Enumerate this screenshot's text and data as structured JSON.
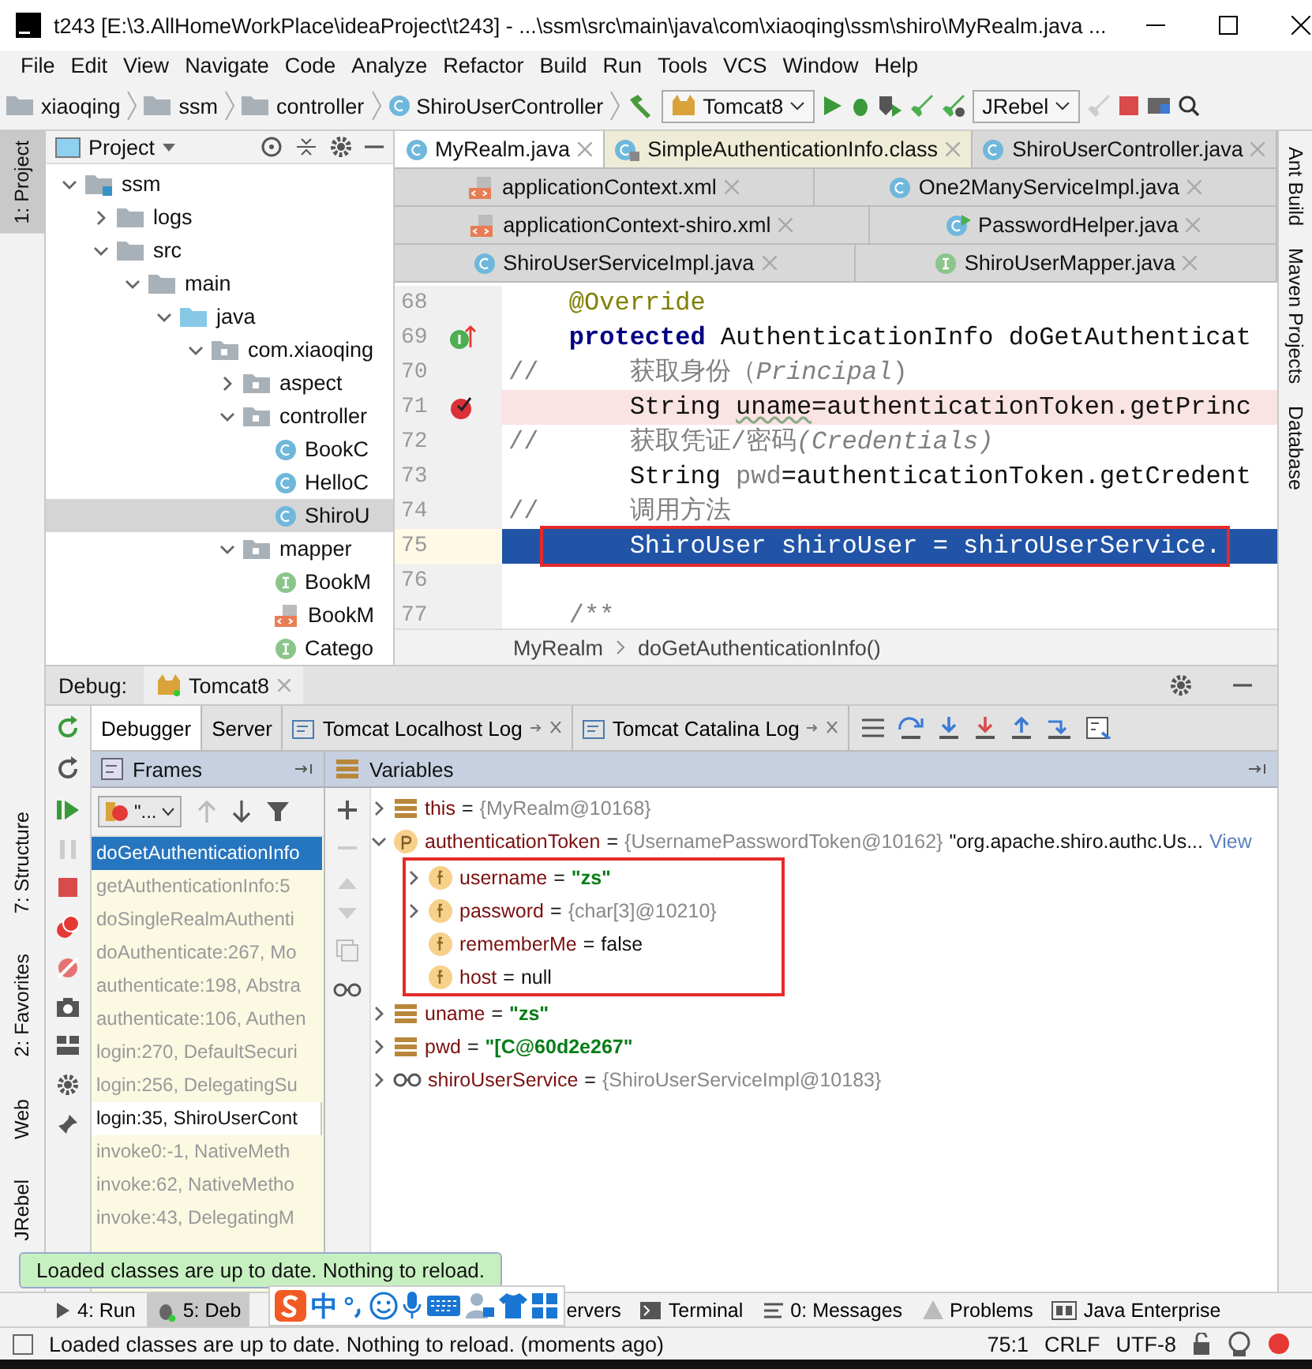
{
  "window": {
    "title": "t243 [E:\\3.AllHomeWorkPlace\\ideaProject\\t243] - ...\\ssm\\src\\main\\java\\com\\xiaoqing\\ssm\\shiro\\MyRealm.java ..."
  },
  "menu": [
    "File",
    "Edit",
    "View",
    "Navigate",
    "Code",
    "Analyze",
    "Refactor",
    "Build",
    "Run",
    "Tools",
    "VCS",
    "Window",
    "Help"
  ],
  "nav_path": [
    {
      "label": "xiaoqing",
      "kind": "folder"
    },
    {
      "label": "ssm",
      "kind": "folder"
    },
    {
      "label": "controller",
      "kind": "folder"
    },
    {
      "label": "ShiroUserController",
      "kind": "class"
    }
  ],
  "run_config": "Tomcat8",
  "jrebel_mode": "JRebel",
  "left_tool_tabs": {
    "top": [
      {
        "label": "1: Project",
        "selected": true
      }
    ],
    "bottom": [
      {
        "label": "7: Structure",
        "selected": false
      },
      {
        "label": "2: Favorites",
        "selected": false
      },
      {
        "label": "Web",
        "selected": false
      },
      {
        "label": "JRebel",
        "selected": false
      }
    ]
  },
  "right_tool_tabs": [
    "Ant Build",
    "Maven Projects",
    "Database"
  ],
  "project": {
    "title": "Project",
    "tree": [
      {
        "label": "ssm",
        "kind": "module",
        "expanded": true,
        "selected": false,
        "children": [
          {
            "label": "logs",
            "kind": "folder",
            "expanded": false,
            "selected": false
          },
          {
            "label": "src",
            "kind": "folder",
            "expanded": true,
            "selected": false,
            "children": [
              {
                "label": "main",
                "kind": "folder",
                "expanded": true,
                "selected": false,
                "children": [
                  {
                    "label": "java",
                    "kind": "source",
                    "expanded": true,
                    "selected": false,
                    "children": [
                      {
                        "label": "com.xiaoqing",
                        "kind": "package",
                        "expanded": true,
                        "selected": false,
                        "children": [
                          {
                            "label": "aspect",
                            "kind": "package",
                            "expanded": false,
                            "selected": false
                          },
                          {
                            "label": "controller",
                            "kind": "package",
                            "expanded": true,
                            "selected": false,
                            "children": [
                              {
                                "label": "BookC",
                                "kind": "class",
                                "selected": false
                              },
                              {
                                "label": "HelloC",
                                "kind": "class",
                                "selected": false
                              },
                              {
                                "label": "ShiroU",
                                "kind": "class",
                                "selected": true
                              }
                            ]
                          },
                          {
                            "label": "mapper",
                            "kind": "package",
                            "expanded": true,
                            "selected": false,
                            "children": [
                              {
                                "label": "BookM",
                                "kind": "interface",
                                "selected": false
                              },
                              {
                                "label": "BookM",
                                "kind": "xml",
                                "selected": false
                              },
                              {
                                "label": "Catego",
                                "kind": "interface",
                                "selected": false
                              }
                            ]
                          }
                        ]
                      }
                    ]
                  }
                ]
              }
            ]
          }
        ]
      }
    ]
  },
  "editor": {
    "tab_rows": [
      [
        {
          "label": "MyRealm.java",
          "kind": "class",
          "selected": true
        },
        {
          "label": "SimpleAuthenticationInfo.class",
          "kind": "library",
          "selected": false
        },
        {
          "label": "ShiroUserController.java",
          "kind": "class",
          "selected": false
        }
      ],
      [
        {
          "label": "applicationContext.xml",
          "kind": "xml",
          "selected": false
        },
        {
          "label": "One2ManyServiceImpl.java",
          "kind": "class",
          "selected": false
        }
      ],
      [
        {
          "label": "applicationContext-shiro.xml",
          "kind": "xml",
          "selected": false
        },
        {
          "label": "PasswordHelper.java",
          "kind": "runnable",
          "selected": false
        }
      ],
      [
        {
          "label": "ShiroUserServiceImpl.java",
          "kind": "class",
          "selected": false
        },
        {
          "label": "ShiroUserMapper.java",
          "kind": "interface",
          "selected": false
        }
      ]
    ],
    "lines": [
      {
        "number": "68",
        "kind": "normal",
        "tokens": [
          {
            "text": "    @Override",
            "kind": "annotation"
          }
        ]
      },
      {
        "number": "69",
        "kind": "override",
        "tokens": [
          {
            "text": "    protected",
            "kind": "keyword"
          },
          {
            "text": " AuthenticationInfo doGetAuthenticat",
            "kind": "plain"
          }
        ]
      },
      {
        "number": "70",
        "kind": "normal",
        "tokens": [
          {
            "text": "//      获取身份（",
            "kind": "comment"
          },
          {
            "text": "Principal",
            "kind": "italic"
          },
          {
            "text": ")",
            "kind": "comment"
          }
        ]
      },
      {
        "number": "71",
        "kind": "breakpoint",
        "tokens": [
          {
            "text": "        String ",
            "kind": "plain"
          },
          {
            "text": "uname",
            "kind": "warning"
          },
          {
            "text": "=authenticationToken.getPrinc",
            "kind": "plain"
          }
        ]
      },
      {
        "number": "72",
        "kind": "normal",
        "tokens": [
          {
            "text": "//      获取凭证/密码",
            "kind": "comment"
          },
          {
            "text": "(Credentials)",
            "kind": "italic"
          }
        ]
      },
      {
        "number": "73",
        "kind": "normal",
        "tokens": [
          {
            "text": "        String ",
            "kind": "plain"
          },
          {
            "text": "pwd",
            "kind": "unused"
          },
          {
            "text": "=authenticationToken.getCredent",
            "kind": "plain"
          }
        ]
      },
      {
        "number": "74",
        "kind": "normal",
        "tokens": [
          {
            "text": "//      调用方法",
            "kind": "comment"
          }
        ]
      },
      {
        "number": "75",
        "kind": "current",
        "annotated": true,
        "tokens": [
          {
            "text": "        ShiroUser shiroUser = shiroUserService.",
            "kind": "plain"
          }
        ]
      },
      {
        "number": "76",
        "kind": "normal"
      },
      {
        "number": "77",
        "kind": "normal",
        "tokens": [
          {
            "text": "    /**",
            "kind": "comment"
          }
        ]
      }
    ],
    "breadcrumbs": [
      "MyRealm",
      "doGetAuthenticationInfo()"
    ]
  },
  "debug": {
    "label": "Debug:",
    "session": "Tomcat8",
    "tabs": [
      {
        "label": "Debugger",
        "selected": true,
        "kind": "plain"
      },
      {
        "label": "Server",
        "selected": false,
        "kind": "plain"
      },
      {
        "label": "Tomcat Localhost Log",
        "selected": false,
        "kind": "log"
      },
      {
        "label": "Tomcat Catalina Log",
        "selected": false,
        "kind": "log"
      }
    ],
    "frames": {
      "title": "Frames",
      "thread": "\"...",
      "items": [
        {
          "text": "doGetAuthenticationInfo",
          "kind": "library",
          "selected": true
        },
        {
          "text": "getAuthenticationInfo:5",
          "kind": "library",
          "selected": false
        },
        {
          "text": "doSingleRealmAuthenti",
          "kind": "library",
          "selected": false
        },
        {
          "text": "doAuthenticate:267, Mo",
          "kind": "library",
          "selected": false
        },
        {
          "text": "authenticate:198, Abstra",
          "kind": "library",
          "selected": false
        },
        {
          "text": "authenticate:106, Authen",
          "kind": "library",
          "selected": false
        },
        {
          "text": "login:270, DefaultSecuri",
          "kind": "library",
          "selected": false
        },
        {
          "text": "login:256, DelegatingSu",
          "kind": "library",
          "selected": false
        },
        {
          "text": "login:35, ShiroUserCont",
          "kind": "project",
          "selected": false
        },
        {
          "text": "invoke0:-1, NativeMeth",
          "kind": "library",
          "selected": false
        },
        {
          "text": "invoke:62, NativeMetho",
          "kind": "library",
          "selected": false
        },
        {
          "text": "invoke:43, DelegatingM",
          "kind": "library",
          "selected": false
        }
      ]
    },
    "variables": {
      "title": "Variables",
      "separator": "=",
      "items": [
        {
          "kind": "local",
          "name": "this",
          "value": {
            "text": "{MyRealm@10168}",
            "kind": "object"
          },
          "expanded": false
        },
        {
          "kind": "param",
          "name": "authenticationToken",
          "value": {
            "text": "{UsernamePasswordToken@10162}",
            "kind": "object"
          },
          "summary": "\"org.apache.shiro.authc.Us...",
          "link": "View",
          "expanded": true,
          "annotated": true,
          "children": [
            {
              "kind": "field",
              "name": "username",
              "value": {
                "text": "\"zs\"",
                "kind": "string"
              },
              "expanded": false
            },
            {
              "kind": "field",
              "name": "password",
              "value": {
                "text": "{char[3]@10210}",
                "kind": "object"
              },
              "expanded": false
            },
            {
              "kind": "field",
              "name": "rememberMe",
              "value": {
                "text": "false",
                "kind": "plain"
              }
            },
            {
              "kind": "field",
              "name": "host",
              "value": {
                "text": "null",
                "kind": "plain"
              }
            }
          ]
        },
        {
          "kind": "local",
          "name": "uname",
          "value": {
            "text": "\"zs\"",
            "kind": "string"
          },
          "expanded": false
        },
        {
          "kind": "local",
          "name": "pwd",
          "value": {
            "text": "\"[C@60d2e267\"",
            "kind": "string"
          },
          "expanded": false
        },
        {
          "kind": "watch",
          "name": "shiroUserService",
          "value": {
            "text": "{ShiroUserServiceImpl@10183}",
            "kind": "object"
          },
          "expanded": false
        }
      ]
    }
  },
  "notification": "Loaded classes are up to date. Nothing to reload.",
  "bottom_tabs": [
    {
      "label": "4: Run",
      "kind": "run",
      "selected": false
    },
    {
      "label": "5: Deb",
      "kind": "debug",
      "selected": true
    },
    {
      "label": "ervers",
      "kind": "plain",
      "selected": false
    },
    {
      "label": "Terminal",
      "kind": "terminal",
      "selected": false
    },
    {
      "label": "0: Messages",
      "kind": "messages",
      "selected": false
    },
    {
      "label": "Problems",
      "kind": "warning",
      "selected": false
    },
    {
      "label": "Java Enterprise",
      "kind": "enterprise",
      "selected": false
    }
  ],
  "ime": {
    "mode": "中"
  },
  "status_bar": {
    "message": "Loaded classes are up to date. Nothing to reload. (moments ago)",
    "position": "75:1",
    "line_separator": "CRLF",
    "encoding": "UTF-8"
  }
}
